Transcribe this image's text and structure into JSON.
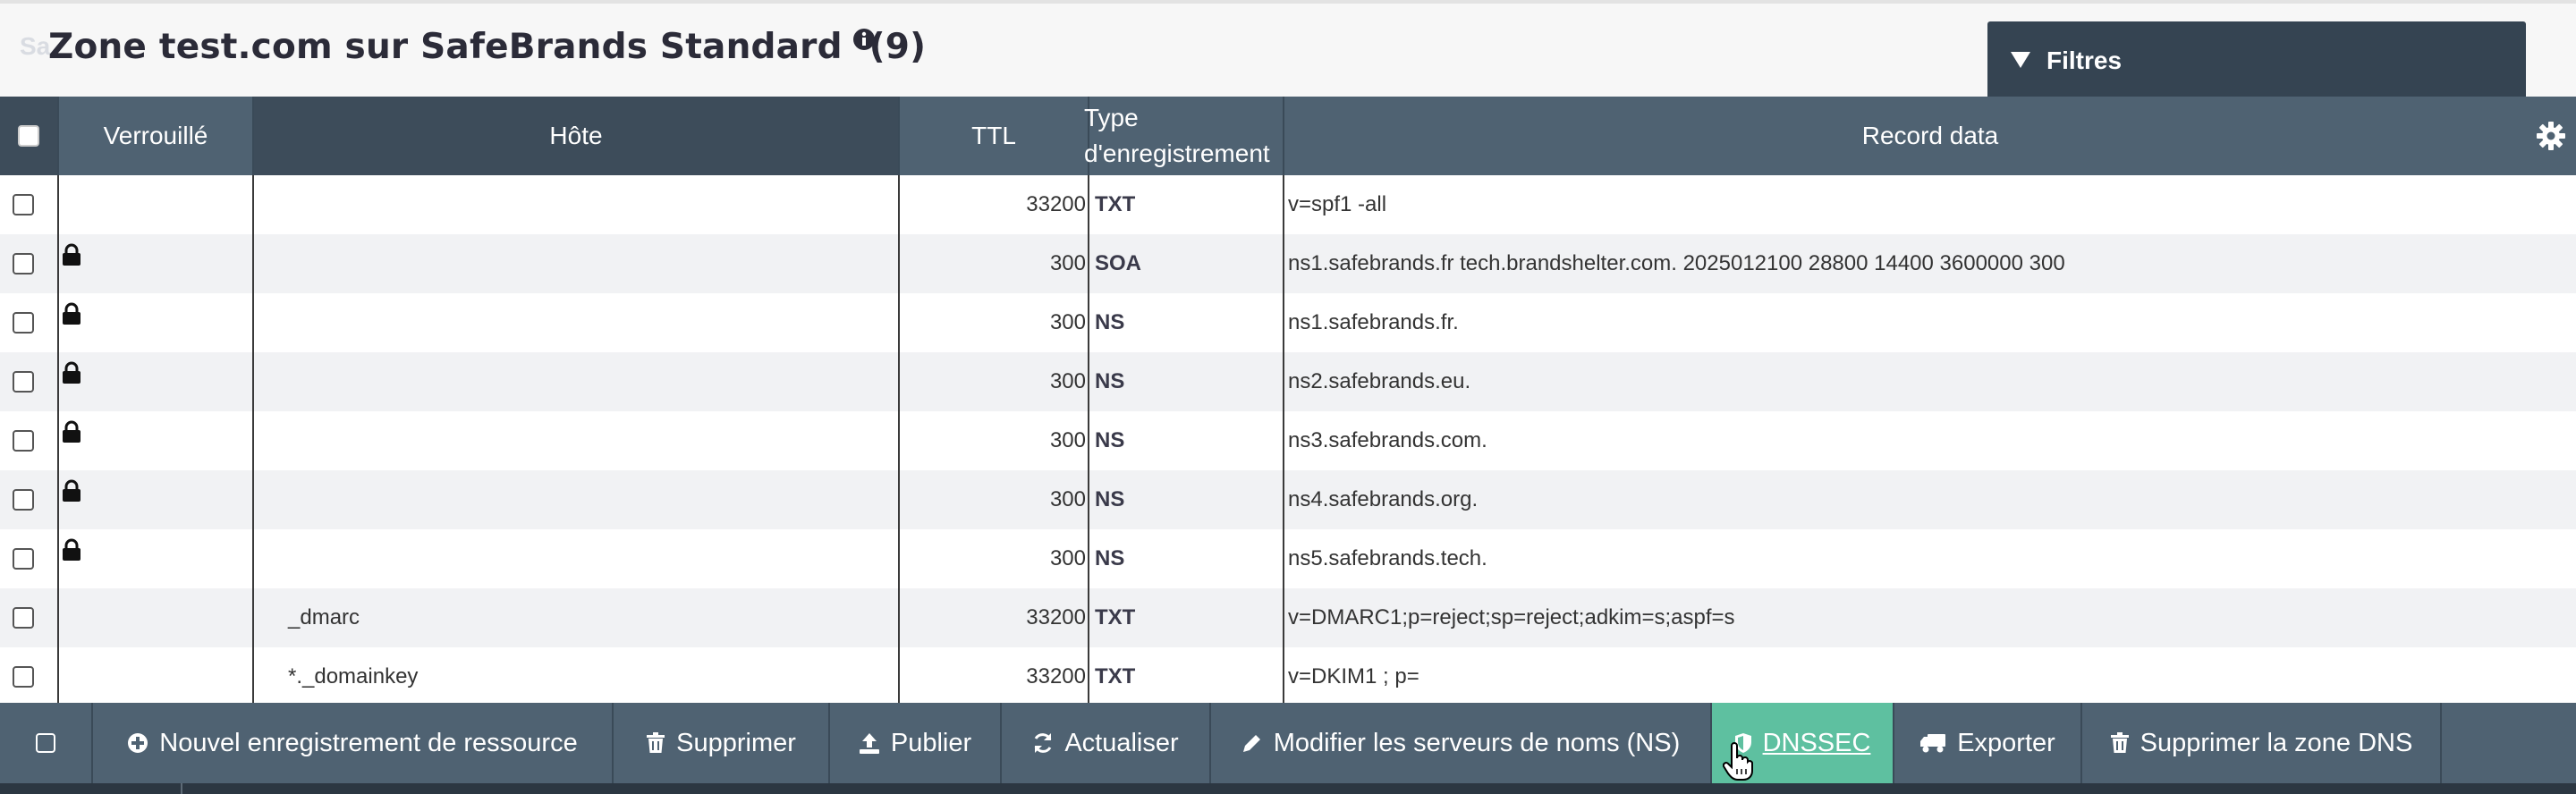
{
  "header": {
    "ghost_text": "Sa",
    "title": "Zone test.com sur SafeBrands Standard",
    "count": "(9)",
    "filters_label": "Filtres"
  },
  "table": {
    "columns": {
      "locked": "Verrouillé",
      "host": "Hôte",
      "ttl": "TTL",
      "type_line1": "Type",
      "type_line2": "d'enregistrement",
      "record_data": "Record data"
    },
    "rows": [
      {
        "locked": false,
        "host": "",
        "ttl": "33200",
        "type": "TXT",
        "data": "v=spf1 -all"
      },
      {
        "locked": true,
        "host": "",
        "ttl": "300",
        "type": "SOA",
        "data": "ns1.safebrands.fr tech.brandshelter.com. 2025012100 28800 14400 3600000 300"
      },
      {
        "locked": true,
        "host": "",
        "ttl": "300",
        "type": "NS",
        "data": "ns1.safebrands.fr."
      },
      {
        "locked": true,
        "host": "",
        "ttl": "300",
        "type": "NS",
        "data": "ns2.safebrands.eu."
      },
      {
        "locked": true,
        "host": "",
        "ttl": "300",
        "type": "NS",
        "data": "ns3.safebrands.com."
      },
      {
        "locked": true,
        "host": "",
        "ttl": "300",
        "type": "NS",
        "data": "ns4.safebrands.org."
      },
      {
        "locked": true,
        "host": "",
        "ttl": "300",
        "type": "NS",
        "data": "ns5.safebrands.tech."
      },
      {
        "locked": false,
        "host": "_dmarc",
        "ttl": "33200",
        "type": "TXT",
        "data": "v=DMARC1;p=reject;sp=reject;adkim=s;aspf=s"
      },
      {
        "locked": false,
        "host": "*._domainkey",
        "ttl": "33200",
        "type": "TXT",
        "data": "v=DKIM1 ; p="
      }
    ]
  },
  "toolbar": {
    "new_record": "Nouvel enregistrement de ressource",
    "delete": "Supprimer",
    "publish": "Publier",
    "refresh": "Actualiser",
    "edit_ns": "Modifier les serveurs de noms (NS)",
    "dnssec": "DNSSEC",
    "export": "Exporter",
    "delete_zone": "Supprimer la zone DNS"
  },
  "colors": {
    "header_bg": "#4f6272",
    "active_button": "#5ec0a0",
    "filters_bg": "#354452"
  },
  "icons": [
    "info-icon",
    "gear-icon",
    "lock-icon",
    "plus-circle-icon",
    "trash-icon",
    "upload-icon",
    "refresh-icon",
    "pencil-icon",
    "shield-icon",
    "truck-icon",
    "hand-cursor-icon"
  ]
}
